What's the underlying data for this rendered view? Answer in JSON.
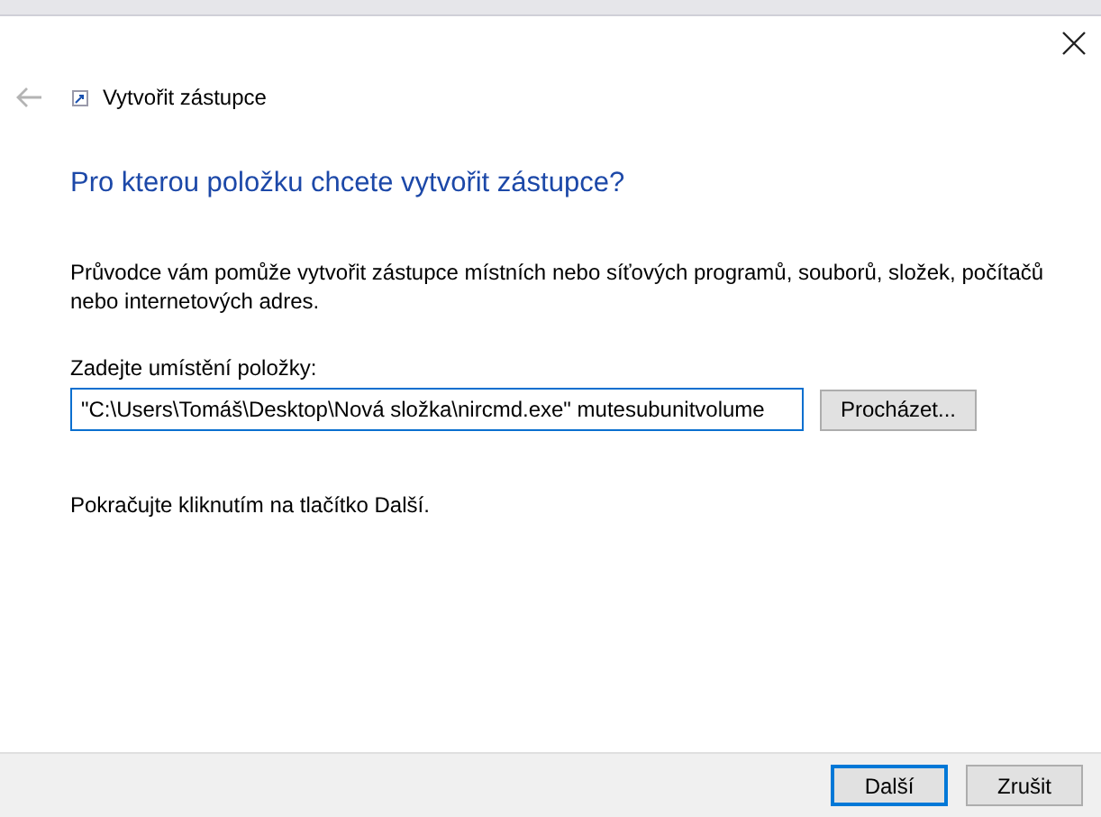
{
  "window": {
    "title": "Vytvořit zástupce",
    "back_disabled": true
  },
  "heading": "Pro kterou položku chcete vytvořit zástupce?",
  "description": "Průvodce vám pomůže vytvořit zástupce místních nebo síťových programů, souborů, složek, počítačů nebo internetových adres.",
  "location": {
    "label": "Zadejte umístění položky:",
    "value": "\"C:\\Users\\Tomáš\\Desktop\\Nová složka\\nircmd.exe\" mutesubunitvolume",
    "browse_button": "Procházet..."
  },
  "hint": "Pokračujte kliknutím na tlačítko Další.",
  "buttons": [
    {
      "label": "Další",
      "default": true
    },
    {
      "label": "Zrušit",
      "default": false
    }
  ]
}
